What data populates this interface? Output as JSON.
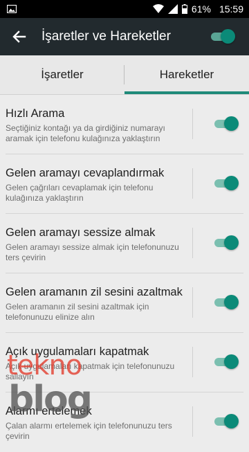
{
  "status_bar": {
    "battery": "61%",
    "time": "15:59"
  },
  "toolbar": {
    "title": "İşaretler ve Hareketler"
  },
  "tabs": [
    {
      "label": "İşaretler"
    },
    {
      "label": "Hareketler"
    }
  ],
  "items": [
    {
      "title": "Hızlı Arama",
      "description": "Seçtiğiniz kontağı ya da girdiğiniz numarayı aramak için telefonu kulağınıza yaklaştırın"
    },
    {
      "title": "Gelen aramayı cevaplandırmak",
      "description": "Gelen çağrıları cevaplamak için telefonu kulağınıza yaklaştırın"
    },
    {
      "title": "Gelen aramayı sessize almak",
      "description": "Gelen aramayı sessize almak için telefonunuzu ters çevirin"
    },
    {
      "title": "Gelen aramanın zil sesini azaltmak",
      "description": "Gelen aramanın zil sesini azaltmak için telefonunuzu elinize alın"
    },
    {
      "title": "Açık uygulamaları kapatmak",
      "description": "Açık uygulamaları kapatmak için telefonunuzu sallayın"
    },
    {
      "title": "Alarmı ertelemek",
      "description": "Çalan alarmı ertelemek için telefonunuzu ters çevirin"
    }
  ],
  "watermark": {
    "line1": "tekno",
    "line2": "blog"
  },
  "colors": {
    "toolbar": "#222a2e",
    "accent": "#1f8a79",
    "toggle_thumb": "#0b8a78",
    "toggle_track": "#7bbfb0"
  }
}
